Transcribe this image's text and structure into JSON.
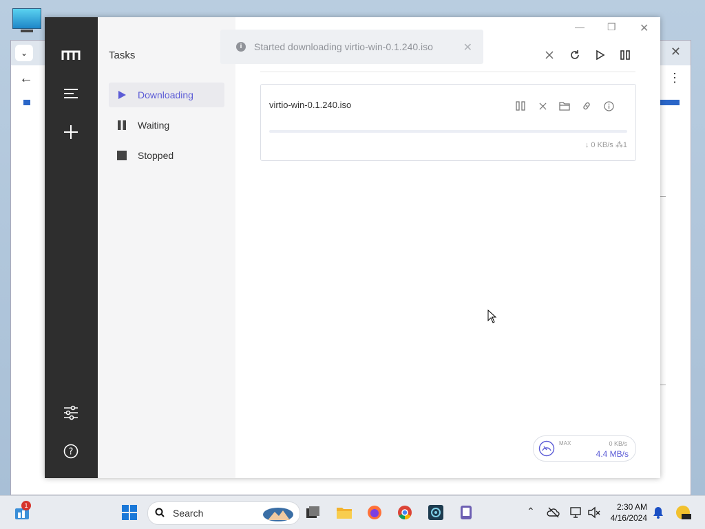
{
  "app": {
    "sidebar_title": "Tasks",
    "menu": [
      {
        "label": "Downloading",
        "icon": "play-icon",
        "active": true
      },
      {
        "label": "Waiting",
        "icon": "pause-icon",
        "active": false
      },
      {
        "label": "Stopped",
        "icon": "stop-icon",
        "active": false
      }
    ],
    "toast": {
      "message": "Started downloading virtio-win-0.1.240.iso"
    },
    "task": {
      "name": "virtio-win-0.1.240.iso",
      "download_speed": "↓ 0 KB/s",
      "connections": "⁂1",
      "progress": 0
    },
    "speedometer": {
      "label": "MAX",
      "upload": "0 KB/s",
      "download": "4.4 MB/s"
    },
    "accent_color": "#5b5bd6"
  },
  "taskbar": {
    "search_label": "Search",
    "time": "2:30 AM",
    "date": "4/16/2024",
    "notification_count": "1"
  }
}
